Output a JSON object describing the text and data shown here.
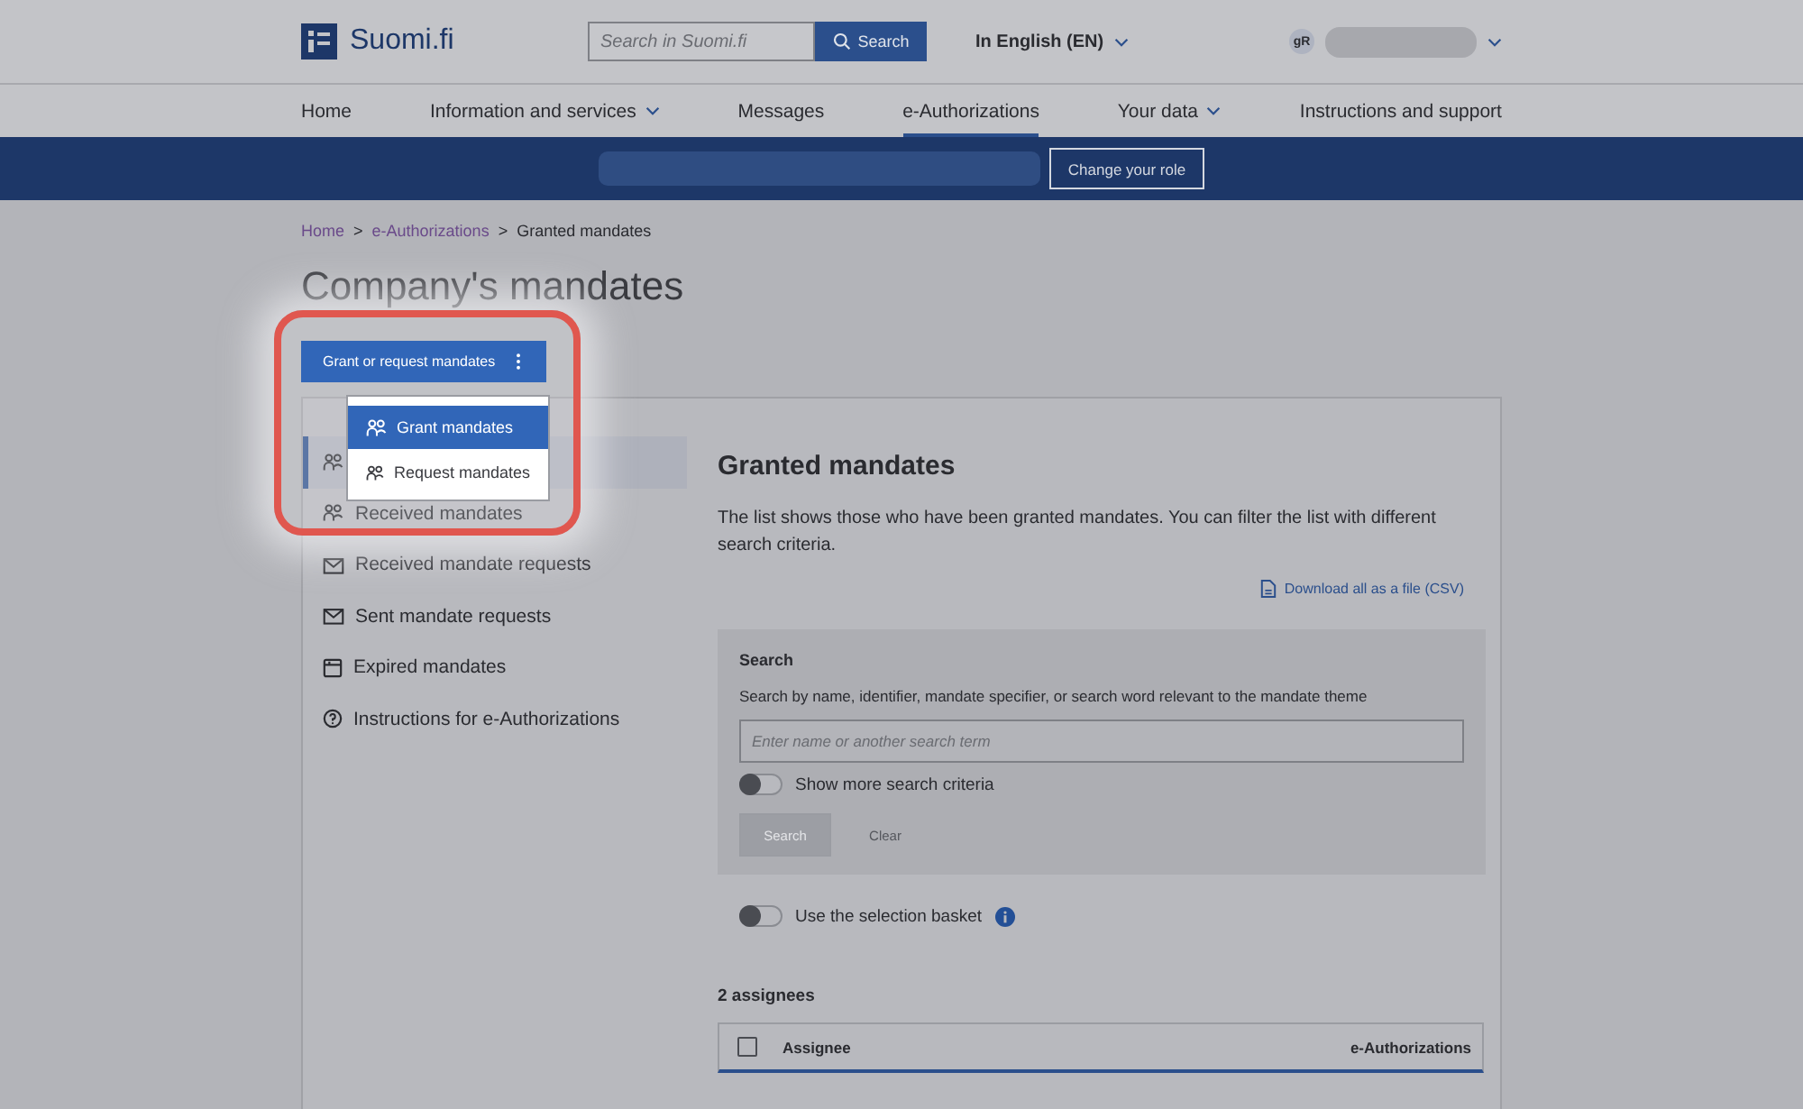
{
  "header": {
    "logo": "Suomi.fi",
    "search": {
      "placeholder": "Search in Suomi.fi",
      "button": "Search"
    },
    "language": "In English (EN)",
    "avatar": "gR"
  },
  "nav": [
    {
      "label": "Home",
      "selected": false,
      "dropdown": false
    },
    {
      "label": "Information and services",
      "selected": false,
      "dropdown": true
    },
    {
      "label": "Messages",
      "selected": false,
      "dropdown": false
    },
    {
      "label": "e-Authorizations",
      "selected": true,
      "dropdown": false
    },
    {
      "label": "Your data",
      "selected": false,
      "dropdown": true
    },
    {
      "label": "Instructions and support",
      "selected": false,
      "dropdown": false
    }
  ],
  "role_bar": {
    "button": "Change your role"
  },
  "breadcrumb": {
    "separator": ">",
    "items": [
      "Home",
      "e-Authorizations",
      "Granted mandates"
    ]
  },
  "title": "Company's mandates",
  "action_button": {
    "label": "Grant or request mandates",
    "expanded": true
  },
  "action_menu": [
    {
      "label": "Grant mandates",
      "selected": true
    },
    {
      "label": "Request mandates",
      "selected": false
    }
  ],
  "sidebar": [
    {
      "kind": "people",
      "selected": true
    },
    {
      "kind": "people",
      "label": "Received mandates",
      "selected": false
    },
    {
      "kind": "mail",
      "label": "Received mandate requests",
      "selected": false
    },
    {
      "kind": "mail",
      "label": "Sent mandate requests",
      "selected": false
    },
    {
      "kind": "archive",
      "label": "Expired mandates",
      "selected": false
    },
    {
      "kind": "help",
      "label": "Instructions for e-Authorizations",
      "selected": false
    }
  ],
  "content": {
    "title": "Granted mandates",
    "description": "The list shows those who have been granted mandates. You can filter the list with different search criteria.",
    "download": "Download all as a file (CSV)",
    "search": {
      "title": "Search",
      "hint": "Search by name, identifier, mandate specifier, or search word relevant to the mandate theme",
      "placeholder": "Enter name or another search term",
      "more_toggle": {
        "label": "Show more search criteria",
        "on": false
      },
      "search_button": {
        "label": "Search",
        "disabled": true
      },
      "clear_button": {
        "label": "Clear",
        "disabled": true
      }
    },
    "basket_toggle": {
      "label": "Use the selection basket",
      "on": false
    },
    "count": "2 assignees",
    "table": {
      "select_all": {
        "checked": false
      },
      "columns": [
        "Assignee",
        "e-Authorizations"
      ]
    }
  }
}
